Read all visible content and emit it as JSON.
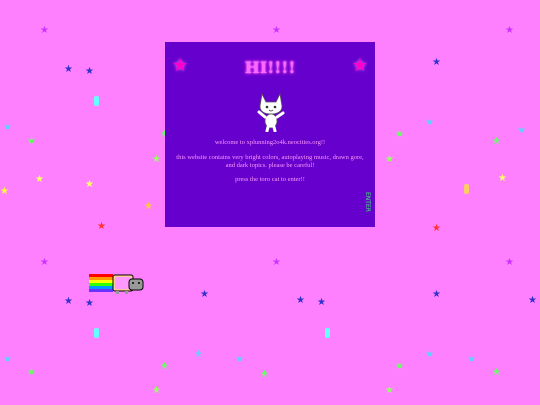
{
  "modal": {
    "title": "HI!!!!",
    "welcome_text": "welcome to xplunning2o4k.neocities.org!!",
    "warning_text": "this website contains very bright colors, autoplaying music, drawn gore, and dark topics. please be careful!",
    "enter_text": "press the toro cat to enter!!",
    "side_label": "ENTER"
  },
  "icons": {
    "corner": "star-icon",
    "cat": "toro-cat-icon",
    "nyan": "nyan-cat-icon"
  },
  "colors": {
    "background": "#ff80ff",
    "modal": "#6600cc",
    "title": "#ff66ff",
    "text": "#ff99ff"
  }
}
